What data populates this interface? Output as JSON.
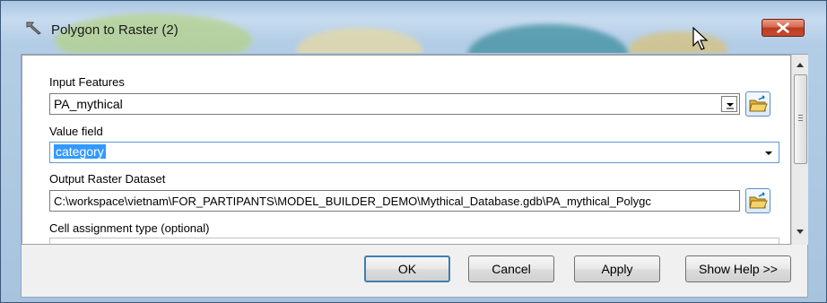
{
  "window": {
    "title": "Polygon to Raster (2)",
    "close_symbol": "x",
    "tool_icon": "hammer-icon"
  },
  "form": {
    "input_features": {
      "label": "Input Features",
      "value": "PA_mythical"
    },
    "value_field": {
      "label": "Value field",
      "value": "category"
    },
    "output_raster": {
      "label": "Output Raster Dataset",
      "value": "C:\\workspace\\vietnam\\FOR_PARTIPANTS\\MODEL_BUILDER_DEMO\\Mythical_Database.gdb\\PA_mythical_Polygc"
    },
    "cell_assignment": {
      "label": "Cell assignment type (optional)"
    }
  },
  "buttons": {
    "ok": "OK",
    "cancel": "Cancel",
    "apply": "Apply",
    "show_help": "Show Help >>"
  },
  "colors": {
    "selection": "#3399ff",
    "close_button": "#c94a2d",
    "default_button_border": "#3c7fb1"
  }
}
